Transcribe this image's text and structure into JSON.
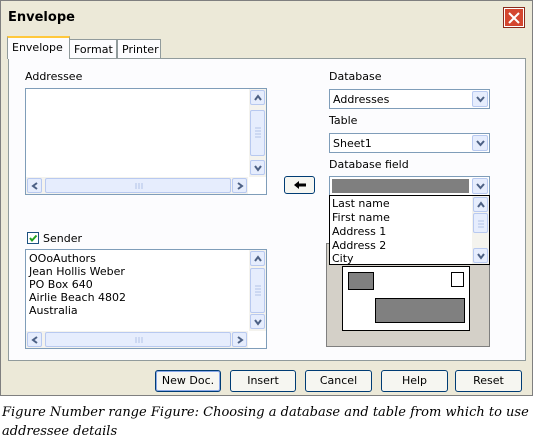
{
  "window": {
    "title": "Envelope"
  },
  "tabs": [
    {
      "label": "Envelope",
      "active": true
    },
    {
      "label": "Format",
      "active": false
    },
    {
      "label": "Printer",
      "active": false
    }
  ],
  "addressee": {
    "label": "Addressee",
    "text": ""
  },
  "database": {
    "label": "Database",
    "value": "Addresses"
  },
  "table": {
    "label": "Table",
    "value": "Sheet1"
  },
  "database_field": {
    "label": "Database field",
    "value": "",
    "options": [
      "Last name",
      "First name",
      "Address 1",
      "Address 2",
      "City"
    ]
  },
  "sender": {
    "label": "Sender",
    "checked": true,
    "lines": [
      "OOoAuthors",
      "Jean Hollis Weber",
      "PO Box 640",
      "Airlie Beach  4802",
      "Australia"
    ]
  },
  "buttons": {
    "new_doc": "New Doc.",
    "insert": "Insert",
    "cancel": "Cancel",
    "help": "Help",
    "reset": "Reset"
  },
  "caption": "Figure Number range Figure: Choosing a database and table from which to use addressee details"
}
